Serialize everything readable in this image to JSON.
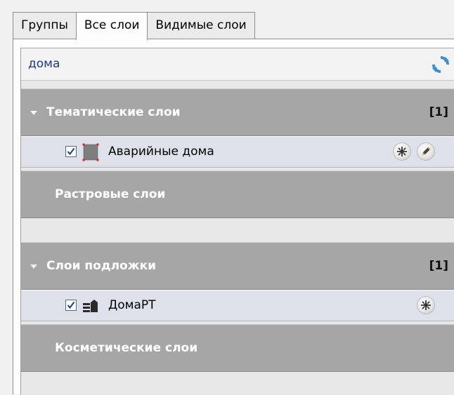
{
  "tabs": [
    {
      "label": "Группы",
      "active": false
    },
    {
      "label": "Все слои",
      "active": true
    },
    {
      "label": "Видимые слои",
      "active": false
    }
  ],
  "search": {
    "value": "дома"
  },
  "groups": [
    {
      "label": "Тематические слои",
      "count": "[1]",
      "expanded": true,
      "layers": [
        {
          "name": "Аварийные дома",
          "checked": true,
          "icon": "polygon-layer-icon",
          "actions": [
            "style-settings-icon",
            "edit-pencil-icon"
          ]
        }
      ]
    },
    {
      "label": "Растровые слои",
      "count": "",
      "expanded": false,
      "layers": []
    },
    {
      "label": "Слои подложки",
      "count": "[1]",
      "expanded": true,
      "layers": [
        {
          "name": "ДомаРТ",
          "checked": true,
          "icon": "stacked-layers-icon",
          "actions": [
            "style-settings-icon"
          ]
        }
      ]
    },
    {
      "label": "Косметические слои",
      "count": "",
      "expanded": false,
      "layers": []
    }
  ],
  "colors": {
    "group_header_bg": "#a6a6a6",
    "layer_row_bg": "#dee1e9",
    "search_text": "#1a3c8c",
    "refresh_icon": "#3a8fd6"
  }
}
